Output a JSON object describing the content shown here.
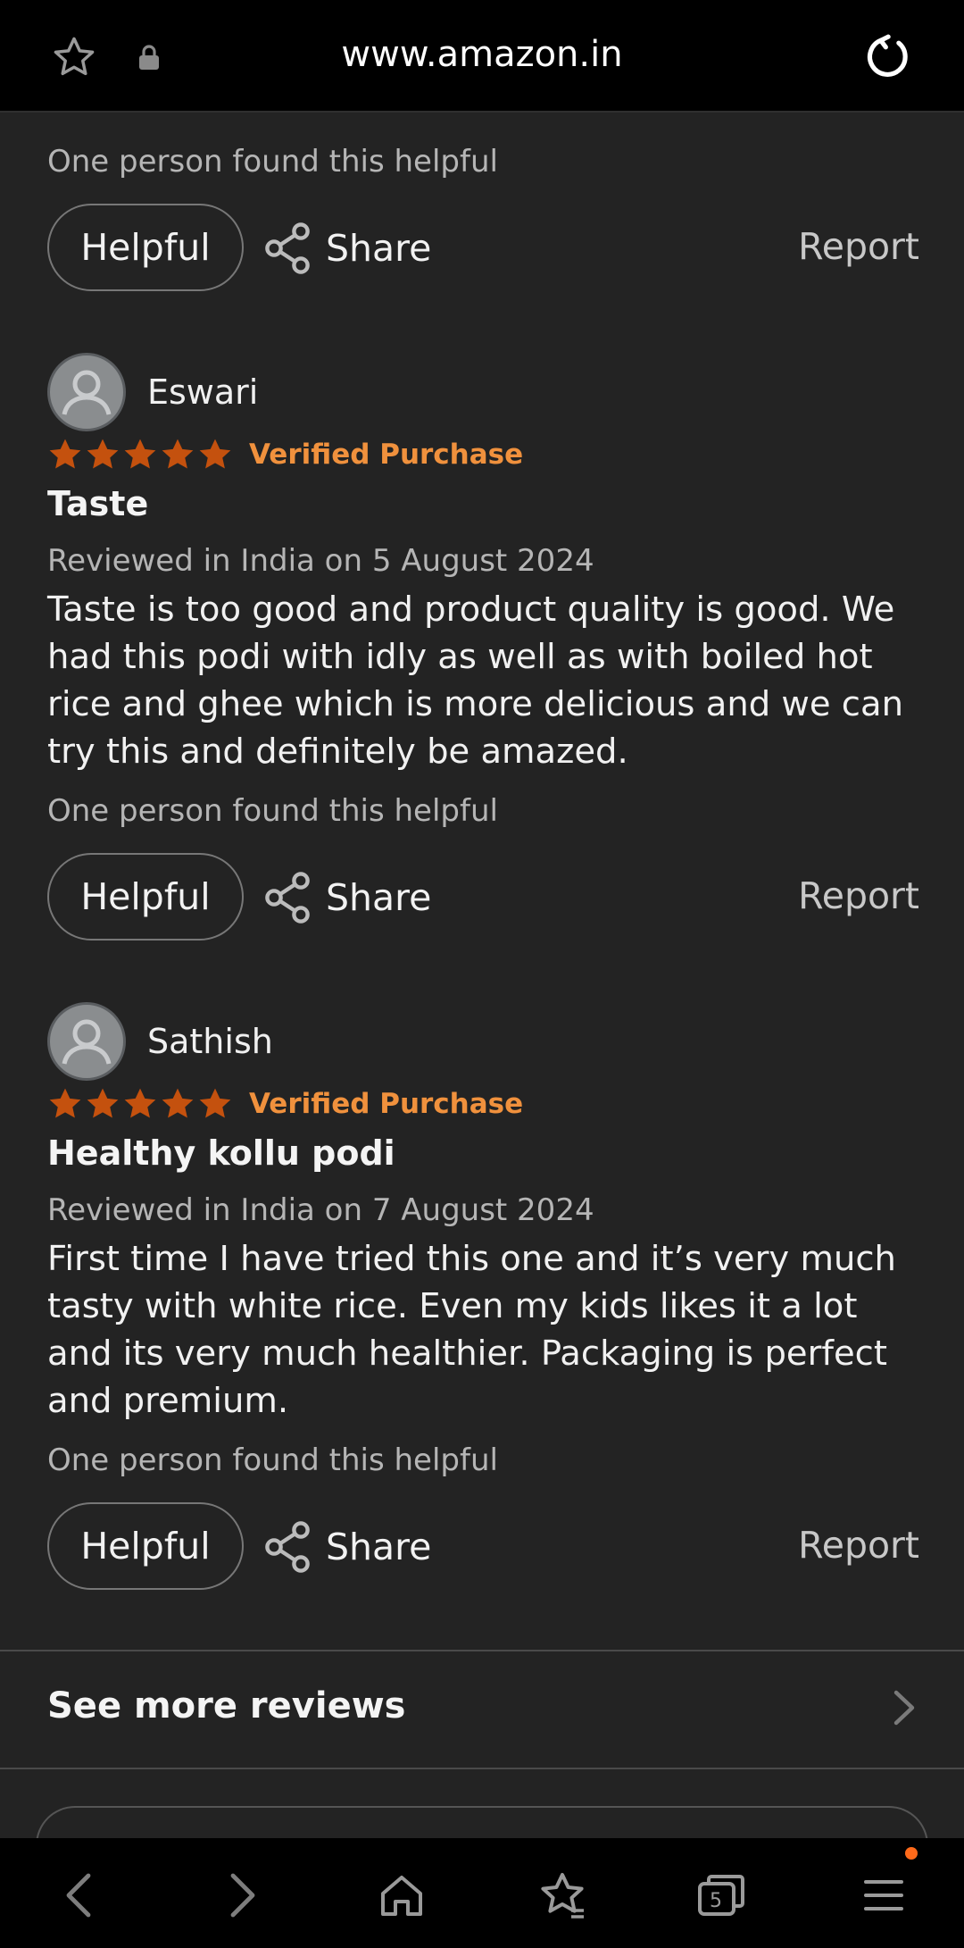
{
  "browser": {
    "url": "www.amazon.in",
    "tab_count": "5"
  },
  "prev_review": {
    "helpful_count": "One person found this helpful"
  },
  "actions": {
    "helpful_label": "Helpful",
    "share_label": "Share",
    "report_label": "Report"
  },
  "reviews": [
    {
      "name": "Eswari",
      "rating": 5,
      "verified": "Verified Purchase",
      "title": "Taste",
      "date": "Reviewed in India on 5 August 2024",
      "body": "Taste is too good and product quality is good. We had this podi with idly as well as with boiled hot rice and ghee which is more delicious and we can try this and definitely be amazed.",
      "helpful_count": "One person found this helpful"
    },
    {
      "name": "Sathish",
      "rating": 5,
      "verified": "Verified Purchase",
      "title": "Healthy kollu podi",
      "date": "Reviewed in India on 7 August 2024",
      "body": "First time I have tried this one and it’s very much tasty with white rice. Even my kids likes it a lot and its very much healthier. Packaging is perfect and premium.",
      "helpful_count": "One person found this helpful"
    }
  ],
  "see_more": {
    "label": "See more reviews"
  },
  "colors": {
    "background": "#232323",
    "star": "#c4510e",
    "verified": "#f0913d",
    "notification": "#ff6a1a"
  }
}
